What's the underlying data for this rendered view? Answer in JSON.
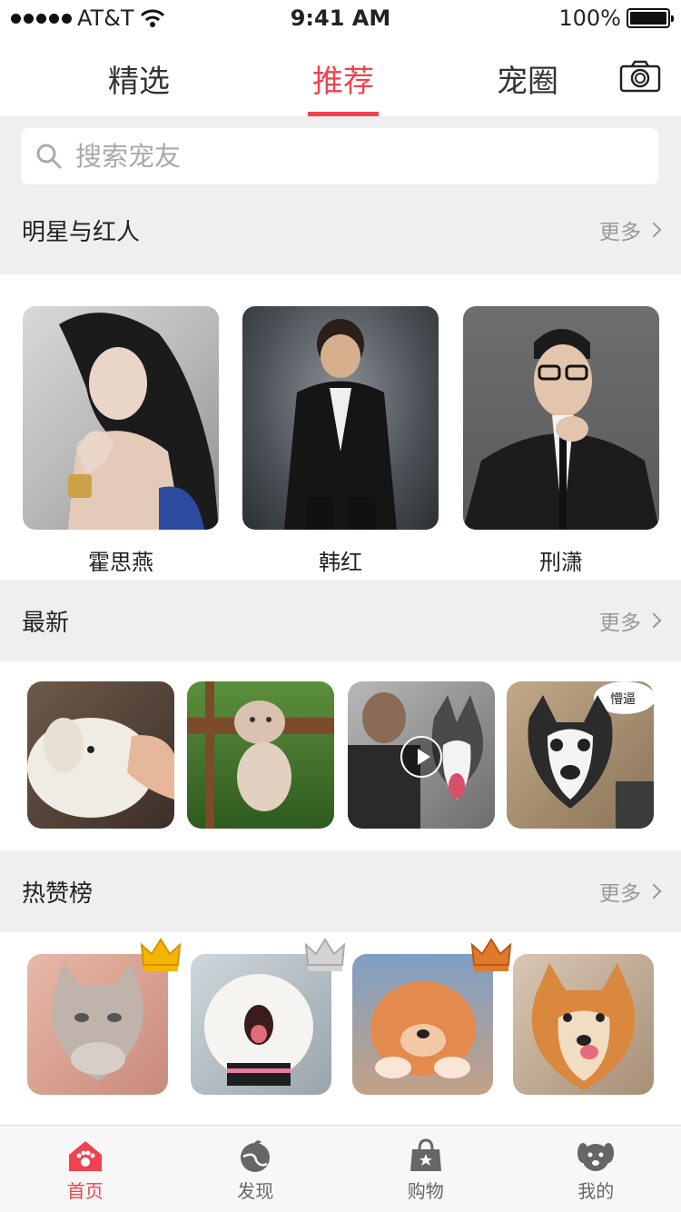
{
  "status_bar": {
    "carrier": "AT&T",
    "time": "9:41 AM",
    "battery": "100%",
    "battery_level": 1.0
  },
  "top_tabs": [
    {
      "label": "精选",
      "active": false
    },
    {
      "label": "推荐",
      "active": true
    },
    {
      "label": "宠圈",
      "active": false
    }
  ],
  "search": {
    "placeholder": "搜索宠友"
  },
  "sections": {
    "celebrities": {
      "title": "明星与红人",
      "more": "更多",
      "items": [
        {
          "name": "霍思燕"
        },
        {
          "name": "韩红"
        },
        {
          "name": "刑潇"
        }
      ]
    },
    "latest": {
      "title": "最新",
      "more": "更多",
      "items": [
        {
          "subject": "puppy"
        },
        {
          "subject": "kitten"
        },
        {
          "subject": "husky-video",
          "is_video": true
        },
        {
          "subject": "husky"
        }
      ]
    },
    "hot_ranking": {
      "title": "热赞榜",
      "more": "更多",
      "items": [
        {
          "subject": "kitten",
          "crown": "gold"
        },
        {
          "subject": "white-pomeranian",
          "crown": "silver"
        },
        {
          "subject": "orange-pomeranian",
          "crown": "bronze"
        },
        {
          "subject": "pomeranian",
          "crown": ""
        }
      ]
    }
  },
  "bottom_nav": [
    {
      "label": "首页",
      "icon": "home-icon",
      "active": true
    },
    {
      "label": "发现",
      "icon": "discover-icon",
      "active": false
    },
    {
      "label": "购物",
      "icon": "shopping-bag-icon",
      "active": false
    },
    {
      "label": "我的",
      "icon": "dog-face-icon",
      "active": false
    }
  ],
  "colors": {
    "accent": "#f0424f",
    "background": "#efefef",
    "gold_crown": "#f5b400",
    "silver_crown": "#c8c8c8",
    "bronze_crown": "#e07a2a"
  }
}
